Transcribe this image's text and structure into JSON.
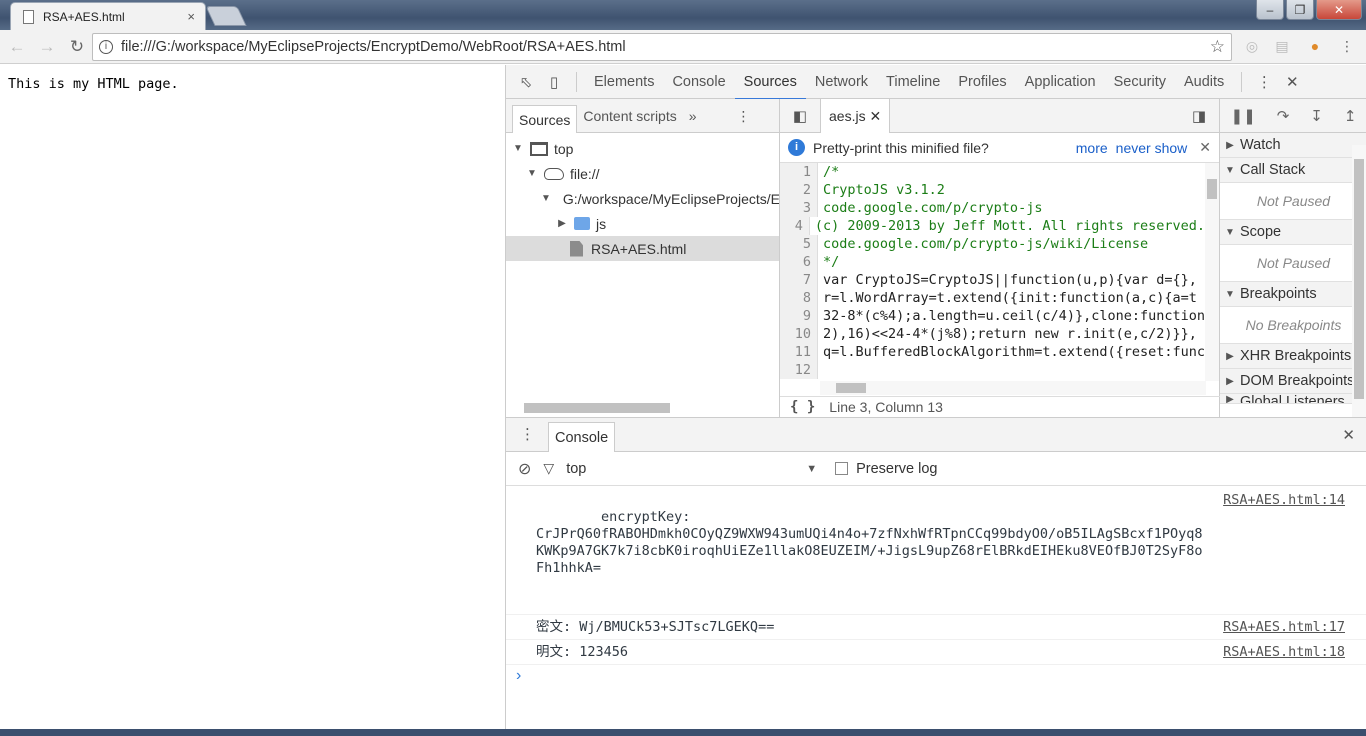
{
  "browser": {
    "tab_title": "RSA+AES.html",
    "tab_close": "×",
    "url": "file:///G:/workspace/MyEclipseProjects/EncryptDemo/WebRoot/RSA+AES.html",
    "window_buttons": [
      "–",
      "❐",
      "✕"
    ]
  },
  "page": {
    "text": "This is my HTML page."
  },
  "devtools": {
    "tabs": [
      "Elements",
      "Console",
      "Sources",
      "Network",
      "Timeline",
      "Profiles",
      "Application",
      "Security",
      "Audits"
    ],
    "active_tab": "Sources",
    "navigator": {
      "tabs": [
        "Sources",
        "Content scripts"
      ],
      "more": "»",
      "tree": [
        {
          "label": "top",
          "level": 0,
          "icon": "frame"
        },
        {
          "label": "file://",
          "level": 1,
          "icon": "cloud"
        },
        {
          "label": "G:/workspace/MyEclipseProjects/EncryptDemo/WebRoot",
          "level": 2,
          "icon": "folder"
        },
        {
          "label": "js",
          "level": 3,
          "icon": "folder"
        },
        {
          "label": "RSA+AES.html",
          "level": 3,
          "icon": "file"
        }
      ]
    },
    "editor": {
      "file_tab": "aes.js",
      "pretty_print_msg": "Pretty-print this minified file?",
      "pretty_more": "more",
      "pretty_never": "never show",
      "lines": [
        "/*",
        "CryptoJS v3.1.2",
        "code.google.com/p/crypto-js",
        "(c) 2009-2013 by Jeff Mott. All rights reserved.",
        "code.google.com/p/crypto-js/wiki/License",
        "*/",
        "var CryptoJS=CryptoJS||function(u,p){var d={},",
        "r=l.WordArray=t.extend({init:function(a,c){a=t",
        "32-8*(c%4);a.length=u.ceil(c/4)},clone:function",
        "2),16)<<24-4*(j%8);return new r.init(e,c/2)}},",
        "q=l.BufferedBlockAlgorithm=t.extend({reset:func",
        ""
      ],
      "status": "Line 3, Column 13",
      "format_icon": "{ }"
    },
    "debugger": {
      "sections": [
        {
          "title": "Watch",
          "body": ""
        },
        {
          "title": "Call Stack",
          "body": "Not Paused"
        },
        {
          "title": "Scope",
          "body": "Not Paused"
        },
        {
          "title": "Breakpoints",
          "body": "No Breakpoints"
        },
        {
          "title": "XHR Breakpoints",
          "body": ""
        },
        {
          "title": "DOM Breakpoints",
          "body": ""
        },
        {
          "title": "Global Listeners",
          "body": ""
        }
      ]
    },
    "drawer": {
      "tab": "Console",
      "context": "top",
      "preserve_log": "Preserve log",
      "messages": [
        {
          "text": "encryptKey:\nCrJPrQ60fRABOHDmkh0COyQZ9WXW943umUQi4n4o+7zfNxhWfRTpnCCq99bdyO0/oB5ILAgSBcxf1POyq8KWKp9A7GK7k7i8cbK0iroqhUiEZe1llakO8EUZEIM/+JigsL9upZ68rElBRkdEIHEku8VEOfBJ0T2SyF8oFh1hhkA=",
          "source": "RSA+AES.html:14"
        },
        {
          "text": "密文: Wj/BMUCk53+SJTsc7LGEKQ==",
          "source": "RSA+AES.html:17"
        },
        {
          "text": "明文: 123456",
          "source": "RSA+AES.html:18"
        }
      ],
      "prompt": "›"
    }
  }
}
